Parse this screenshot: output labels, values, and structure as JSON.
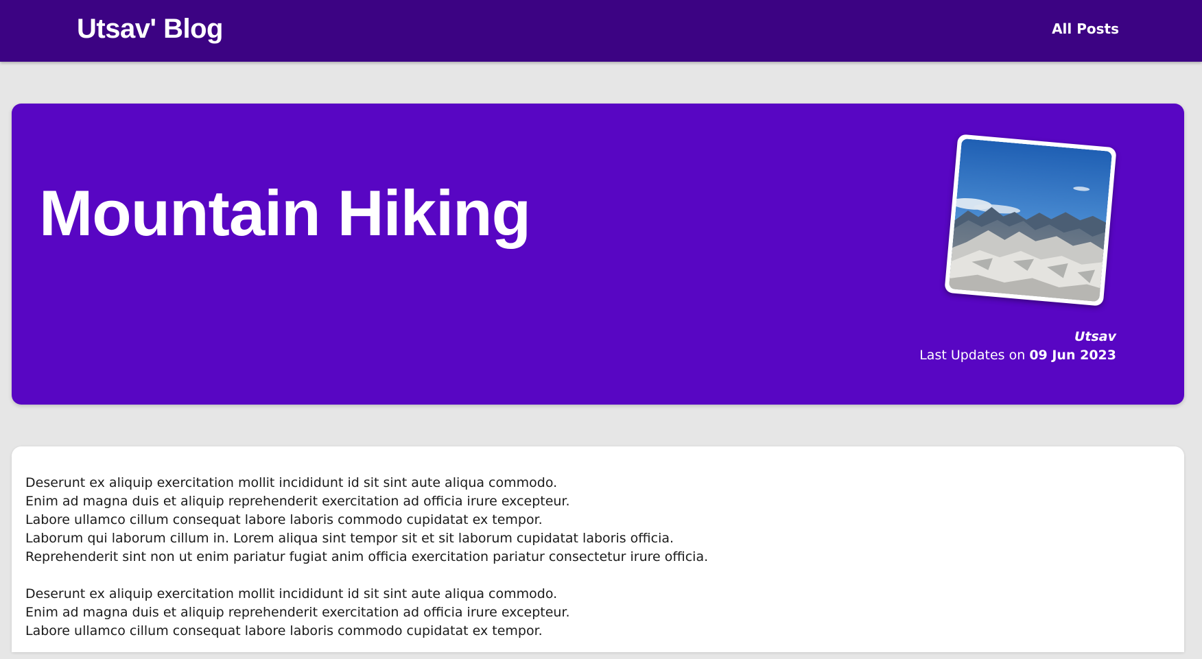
{
  "header": {
    "brand": "Utsav' Blog",
    "nav_all_posts": "All Posts",
    "background_color": "#3c0383"
  },
  "hero": {
    "title": "Mountain Hiking",
    "background_color": "#5806c3",
    "image_icon": "mountain-photo",
    "author": "Utsav",
    "updated_prefix": "Last Updates on",
    "updated_date": "09 Jun 2023"
  },
  "content": {
    "paragraphs": [
      {
        "lines": [
          "Deserunt ex aliquip exercitation mollit incididunt id sit sint aute aliqua commodo.",
          "Enim ad magna duis et aliquip reprehenderit exercitation ad officia irure excepteur.",
          "Labore ullamco cillum consequat labore laboris commodo cupidatat ex tempor.",
          "Laborum qui laborum cillum in. Lorem aliqua sint tempor sit et sit laborum cupidatat laboris officia.",
          "Reprehenderit sint non ut enim pariatur fugiat anim officia exercitation pariatur consectetur irure officia."
        ]
      },
      {
        "lines": [
          "Deserunt ex aliquip exercitation mollit incididunt id sit sint aute aliqua commodo.",
          "Enim ad magna duis et aliquip reprehenderit exercitation ad officia irure excepteur.",
          "Labore ullamco cillum consequat labore laboris commodo cupidatat ex tempor."
        ]
      }
    ]
  }
}
